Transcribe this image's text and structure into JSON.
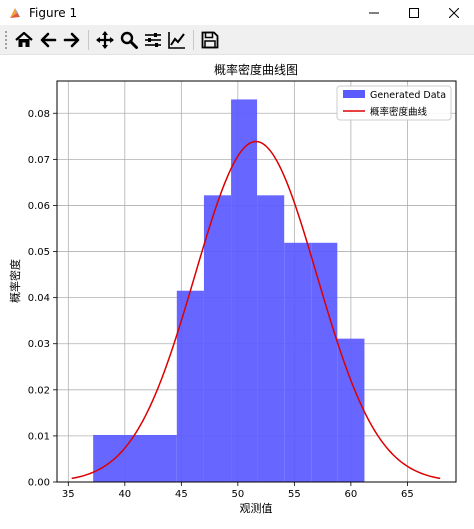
{
  "window": {
    "title": "Figure 1",
    "controls": [
      "minimize",
      "maximize",
      "close"
    ]
  },
  "toolbar": {
    "buttons": [
      "home-icon",
      "back-icon",
      "forward-icon",
      "pan-icon",
      "zoom-icon",
      "configure-subplots-icon",
      "edit-axis-icon",
      "save-icon"
    ]
  },
  "chart_data": {
    "type": "bar",
    "title": "概率密度曲线图",
    "xlabel": "观测值",
    "ylabel": "概率密度",
    "xlim": [
      34.0,
      69.3
    ],
    "ylim": [
      0.0,
      0.087
    ],
    "xticks": [
      "35",
      "40",
      "45",
      "50",
      "55",
      "60",
      "65"
    ],
    "xtick_values": [
      35,
      40,
      45,
      50,
      55,
      60,
      65
    ],
    "yticks": [
      "0.00",
      "0.01",
      "0.02",
      "0.03",
      "0.04",
      "0.05",
      "0.06",
      "0.07",
      "0.08"
    ],
    "ytick_values": [
      0.0,
      0.01,
      0.02,
      0.03,
      0.04,
      0.05,
      0.06,
      0.07,
      0.08
    ],
    "grid": true,
    "legend_position": "top-right",
    "histogram": {
      "name": "Generated Data",
      "color": "#5a5aff",
      "bin_edges": [
        37.2,
        44.6,
        47.0,
        49.4,
        51.7,
        54.1,
        56.5,
        58.8,
        61.2
      ],
      "values": [
        0.0102,
        0.0415,
        0.0622,
        0.083,
        0.0622,
        0.0519,
        0.0519,
        0.0311
      ]
    },
    "curve": {
      "name": "概率密度曲线",
      "color": "#dd0000",
      "distribution": "normal",
      "mean": 51.6,
      "std": 5.4,
      "x_range": [
        35.3,
        67.9
      ]
    }
  }
}
